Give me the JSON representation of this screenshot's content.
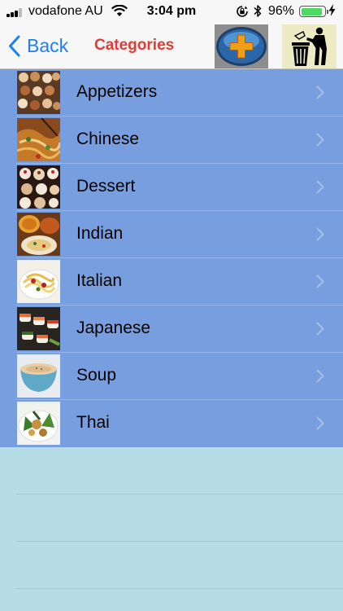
{
  "status_bar": {
    "carrier": "vodafone AU",
    "time": "3:04 pm",
    "battery_percent": "96%",
    "battery_level": 0.96,
    "signal_bars": 3
  },
  "nav": {
    "back_label": "Back",
    "title": "Categories",
    "add_icon": "plus-button-icon",
    "trash_icon": "recycle-bin-icon"
  },
  "colors": {
    "title": "#e23c35",
    "back": "#1f7ef6",
    "list_bg": "#779fe0",
    "empty_bg": "#b6dce5"
  },
  "categories": [
    {
      "label": "Appetizers",
      "thumb": "appetizers-photo"
    },
    {
      "label": "Chinese",
      "thumb": "chinese-food-photo"
    },
    {
      "label": "Dessert",
      "thumb": "dessert-photo"
    },
    {
      "label": "Indian",
      "thumb": "indian-food-photo"
    },
    {
      "label": "Italian",
      "thumb": "italian-food-photo"
    },
    {
      "label": "Japanese",
      "thumb": "japanese-food-photo"
    },
    {
      "label": "Soup",
      "thumb": "soup-photo"
    },
    {
      "label": "Thai",
      "thumb": "thai-food-photo"
    }
  ]
}
